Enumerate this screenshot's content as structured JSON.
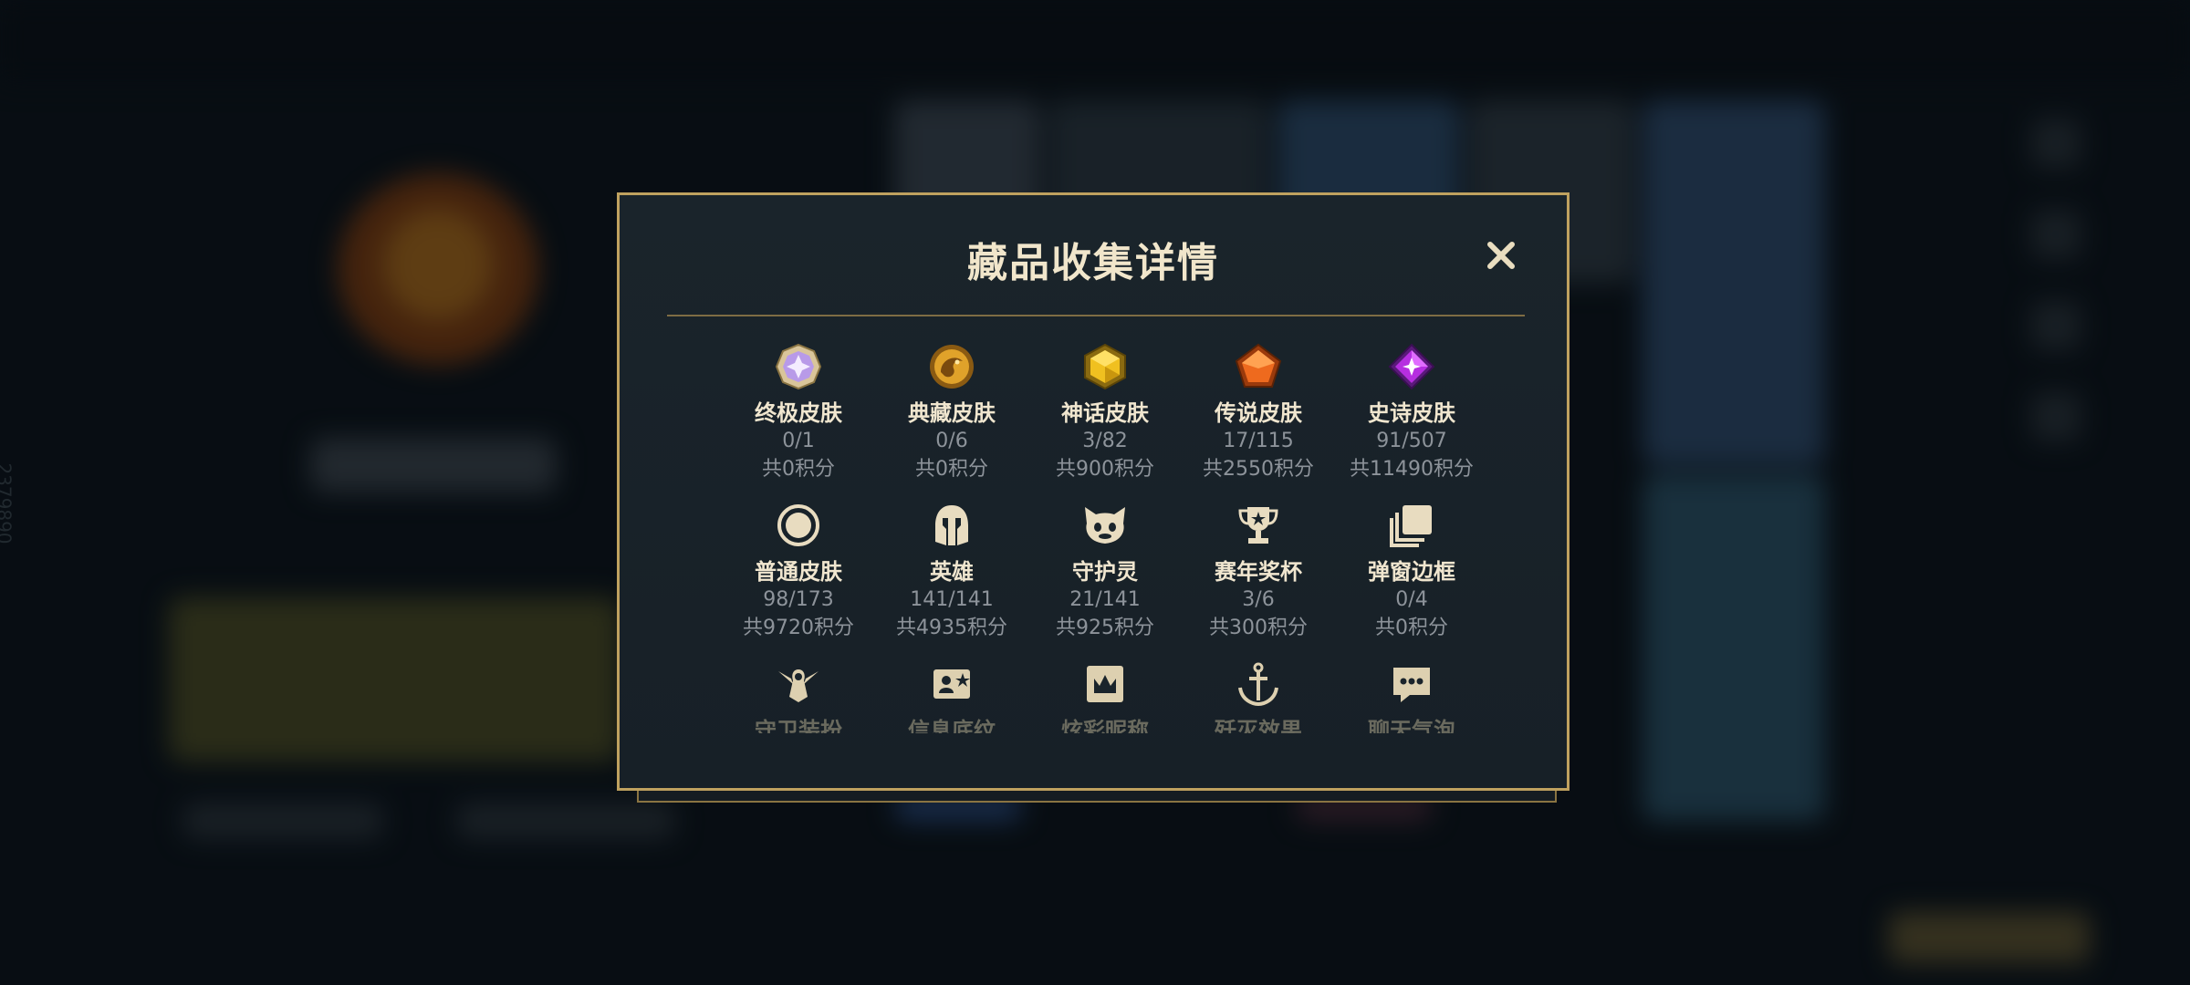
{
  "background": {
    "title": "",
    "side_id": "2379890"
  },
  "modal": {
    "title": "藏品收集详情",
    "close_label": "✕",
    "accent_color": "#bfa15f"
  },
  "items": [
    {
      "name": "终极皮肤",
      "count": "0/1",
      "points": "共0积分",
      "icon": "ultimate-gem-icon"
    },
    {
      "name": "典藏皮肤",
      "count": "0/6",
      "points": "共0积分",
      "icon": "dragon-emblem-icon"
    },
    {
      "name": "神话皮肤",
      "count": "3/82",
      "points": "共900积分",
      "icon": "mythic-gem-icon"
    },
    {
      "name": "传说皮肤",
      "count": "17/115",
      "points": "共2550积分",
      "icon": "legendary-gem-icon"
    },
    {
      "name": "史诗皮肤",
      "count": "91/507",
      "points": "共11490积分",
      "icon": "epic-gem-icon"
    },
    {
      "name": "普通皮肤",
      "count": "98/173",
      "points": "共9720积分",
      "icon": "ring-icon"
    },
    {
      "name": "英雄",
      "count": "141/141",
      "points": "共4935积分",
      "icon": "helmet-icon"
    },
    {
      "name": "守护灵",
      "count": "21/141",
      "points": "共925积分",
      "icon": "guardian-pet-icon"
    },
    {
      "name": "赛年奖杯",
      "count": "3/6",
      "points": "共300积分",
      "icon": "trophy-icon"
    },
    {
      "name": "弹窗边框",
      "count": "0/4",
      "points": "共0积分",
      "icon": "stacked-frames-icon"
    },
    {
      "name": "守卫装扮",
      "icon": "ward-skin-icon"
    },
    {
      "name": "信息底纹",
      "icon": "info-card-icon"
    },
    {
      "name": "炫彩昵称",
      "icon": "crown-name-icon"
    },
    {
      "name": "歼灭效果",
      "icon": "anchor-icon"
    },
    {
      "name": "聊天气泡",
      "icon": "chat-bubble-icon"
    }
  ]
}
